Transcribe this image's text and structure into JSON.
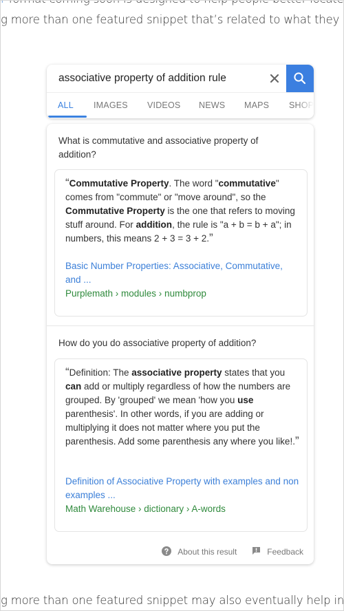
{
  "article": {
    "line1_link_fragment": "r",
    "line1_text": " format coming soon is designed to help people better locate information",
    "line2_text": "g more than one featured snippet that’s related to what they originally se",
    "line3_text": "g more than one featured snippet may also eventually help in cases whe"
  },
  "search": {
    "query": "associative property of addition rule",
    "clear_icon": "close-icon",
    "search_icon": "magnifier-icon",
    "accent_color": "#3b7fe0"
  },
  "tabs": [
    {
      "label": "ALL",
      "active": true
    },
    {
      "label": "IMAGES",
      "active": false
    },
    {
      "label": "VIDEOS",
      "active": false
    },
    {
      "label": "NEWS",
      "active": false
    },
    {
      "label": "MAPS",
      "active": false
    },
    {
      "label": "SHOP",
      "active": false
    }
  ],
  "results": [
    {
      "question": "What is commutative and associative property of addition?",
      "snippet_html": "<span class=\"quote\">“</span><b>Commutative Property</b>. The word \"<b>commutative</b>\" comes from \"commute\" or \"move around\", so the <b>Commutative Property</b> is the one that refers to moving stuff around. For <b>addition</b>, the rule is \"a + b = b + a\"; in numbers, this means 2 + 3 = 3 + 2.<span class=\"quote\">”</span>",
      "source_title": "Basic Number Properties: Associative, Commutative, and ...",
      "source_path": "Purplemath › modules › numbprop"
    },
    {
      "question": "How do you do associative property of addition?",
      "snippet_html": "<span class=\"quote\">“</span>Definition: The <b>associative property</b> states that you <b>can</b> add or multiply regardless of how the numbers are grouped. By 'grouped' we mean 'how you <b>use</b> parenthesis'. In other words, if you are adding or multiplying it does not matter where you put the parenthesis. Add some parenthesis any where you like!.<span class=\"quote\">”</span>",
      "source_title": "Definition of Associative Property with examples and non examples ...",
      "source_path": "Math Warehouse › dictionary › A-words"
    }
  ],
  "footer": {
    "about_label": "About this result",
    "about_icon": "help-circle-icon",
    "feedback_label": "Feedback",
    "feedback_icon": "feedback-icon"
  },
  "colors": {
    "link_blue": "#3b7fd8",
    "url_green": "#2f8a3c",
    "tab_active": "#3b82e0"
  }
}
